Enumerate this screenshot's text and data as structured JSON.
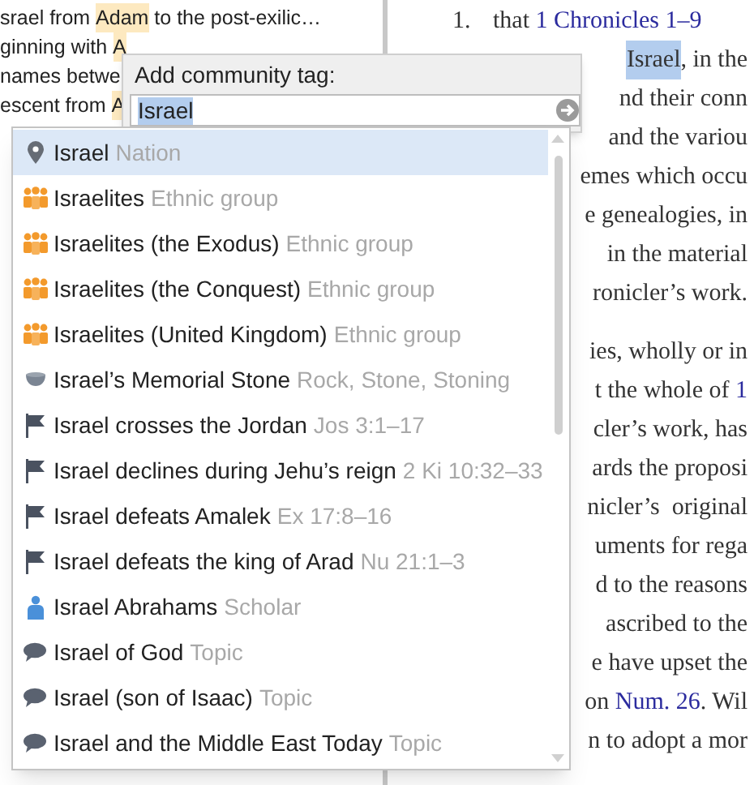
{
  "left_pane": {
    "lines": [
      {
        "parts": [
          {
            "text": "srael from ",
            "highlight": false
          },
          {
            "text": "Adam",
            "highlight": true
          },
          {
            "text": " to the post-exilic…",
            "highlight": false
          }
        ]
      },
      {
        "parts": [
          {
            "text": "ginning with ",
            "highlight": false
          },
          {
            "text": "A",
            "highlight": true
          }
        ]
      },
      {
        "parts": [
          {
            "text": "names betwe",
            "highlight": false
          }
        ]
      },
      {
        "parts": [
          {
            "text": "escent from ",
            "highlight": false
          },
          {
            "text": "A",
            "highlight": true
          }
        ]
      }
    ]
  },
  "right_pane": {
    "number": "1.",
    "lines": [
      {
        "parts": [
          {
            "text": "that ",
            "link": false
          },
          {
            "text": "1 Chronicles 1–9",
            "link": true
          }
        ]
      },
      {
        "parts": [
          {
            "text": "Israel",
            "link": false,
            "selected": true
          },
          {
            "text": ", in the",
            "link": false
          }
        ]
      },
      {
        "parts": [
          {
            "text": "nd their conn",
            "link": false
          }
        ]
      },
      {
        "parts": [
          {
            "text": "and the variou",
            "link": false
          }
        ]
      },
      {
        "parts": [
          {
            "text": "emes which occu",
            "link": false
          }
        ]
      },
      {
        "parts": [
          {
            "text": "e genealogies, in",
            "link": false
          }
        ]
      },
      {
        "parts": [
          {
            "text": "in the material",
            "link": false
          }
        ]
      },
      {
        "parts": [
          {
            "text": "ronicler’s work.",
            "link": false
          }
        ]
      },
      {
        "parts": [
          {
            "text": "ies, wholly or in",
            "link": false
          }
        ]
      },
      {
        "parts": [
          {
            "text": "t the whole of ",
            "link": false
          },
          {
            "text": "1",
            "link": true
          }
        ]
      },
      {
        "parts": [
          {
            "text": "cler’s work, has",
            "link": false
          }
        ]
      },
      {
        "parts": [
          {
            "text": "ards the proposi",
            "link": false
          }
        ]
      },
      {
        "parts": [
          {
            "text": "nicler’s  original",
            "link": false
          }
        ]
      },
      {
        "parts": [
          {
            "text": "uments for rega",
            "link": false
          }
        ]
      },
      {
        "parts": [
          {
            "text": "d to the reasons",
            "link": false
          }
        ]
      },
      {
        "parts": [
          {
            "text": "ascribed to the",
            "link": false
          }
        ]
      },
      {
        "parts": [
          {
            "text": "e have upset the",
            "link": false
          }
        ]
      },
      {
        "parts": [
          {
            "text": "on ",
            "link": false
          },
          {
            "text": "Num. 26",
            "link": true
          },
          {
            "text": ". Wil",
            "link": false
          }
        ]
      },
      {
        "parts": [
          {
            "text": "n to adopt a mor",
            "link": false
          }
        ]
      }
    ]
  },
  "tag_popup": {
    "title": "Add community tag:",
    "value": "Israel",
    "suggestions": [
      {
        "kind": "place",
        "name": "Israel",
        "category": "Nation",
        "selected": true
      },
      {
        "kind": "group",
        "name": "Israelites",
        "category": "Ethnic group",
        "selected": false
      },
      {
        "kind": "group",
        "name": "Israelites (the Exodus)",
        "category": "Ethnic group",
        "selected": false
      },
      {
        "kind": "group",
        "name": "Israelites (the Conquest)",
        "category": "Ethnic group",
        "selected": false
      },
      {
        "kind": "group",
        "name": "Israelites (United Kingdom)",
        "category": "Ethnic group",
        "selected": false
      },
      {
        "kind": "stone",
        "name": "Israel’s Memorial Stone",
        "category": "Rock, Stone, Stoning",
        "selected": false
      },
      {
        "kind": "event",
        "name": "Israel crosses the Jordan",
        "category": "Jos 3:1–17",
        "selected": false
      },
      {
        "kind": "event",
        "name": "Israel declines during Jehu’s reign",
        "category": "2 Ki 10:32–33",
        "selected": false
      },
      {
        "kind": "event",
        "name": "Israel defeats Amalek",
        "category": "Ex 17:8–16",
        "selected": false
      },
      {
        "kind": "event",
        "name": "Israel defeats the king of Arad",
        "category": "Nu 21:1–3",
        "selected": false
      },
      {
        "kind": "person",
        "name": "Israel Abrahams",
        "category": "Scholar",
        "selected": false
      },
      {
        "kind": "topic",
        "name": "Israel of God",
        "category": "Topic",
        "selected": false
      },
      {
        "kind": "topic",
        "name": "Israel (son of Isaac)",
        "category": "Topic",
        "selected": false
      },
      {
        "kind": "topic",
        "name": "Israel and the Middle East Today",
        "category": "Topic",
        "selected": false
      }
    ]
  }
}
